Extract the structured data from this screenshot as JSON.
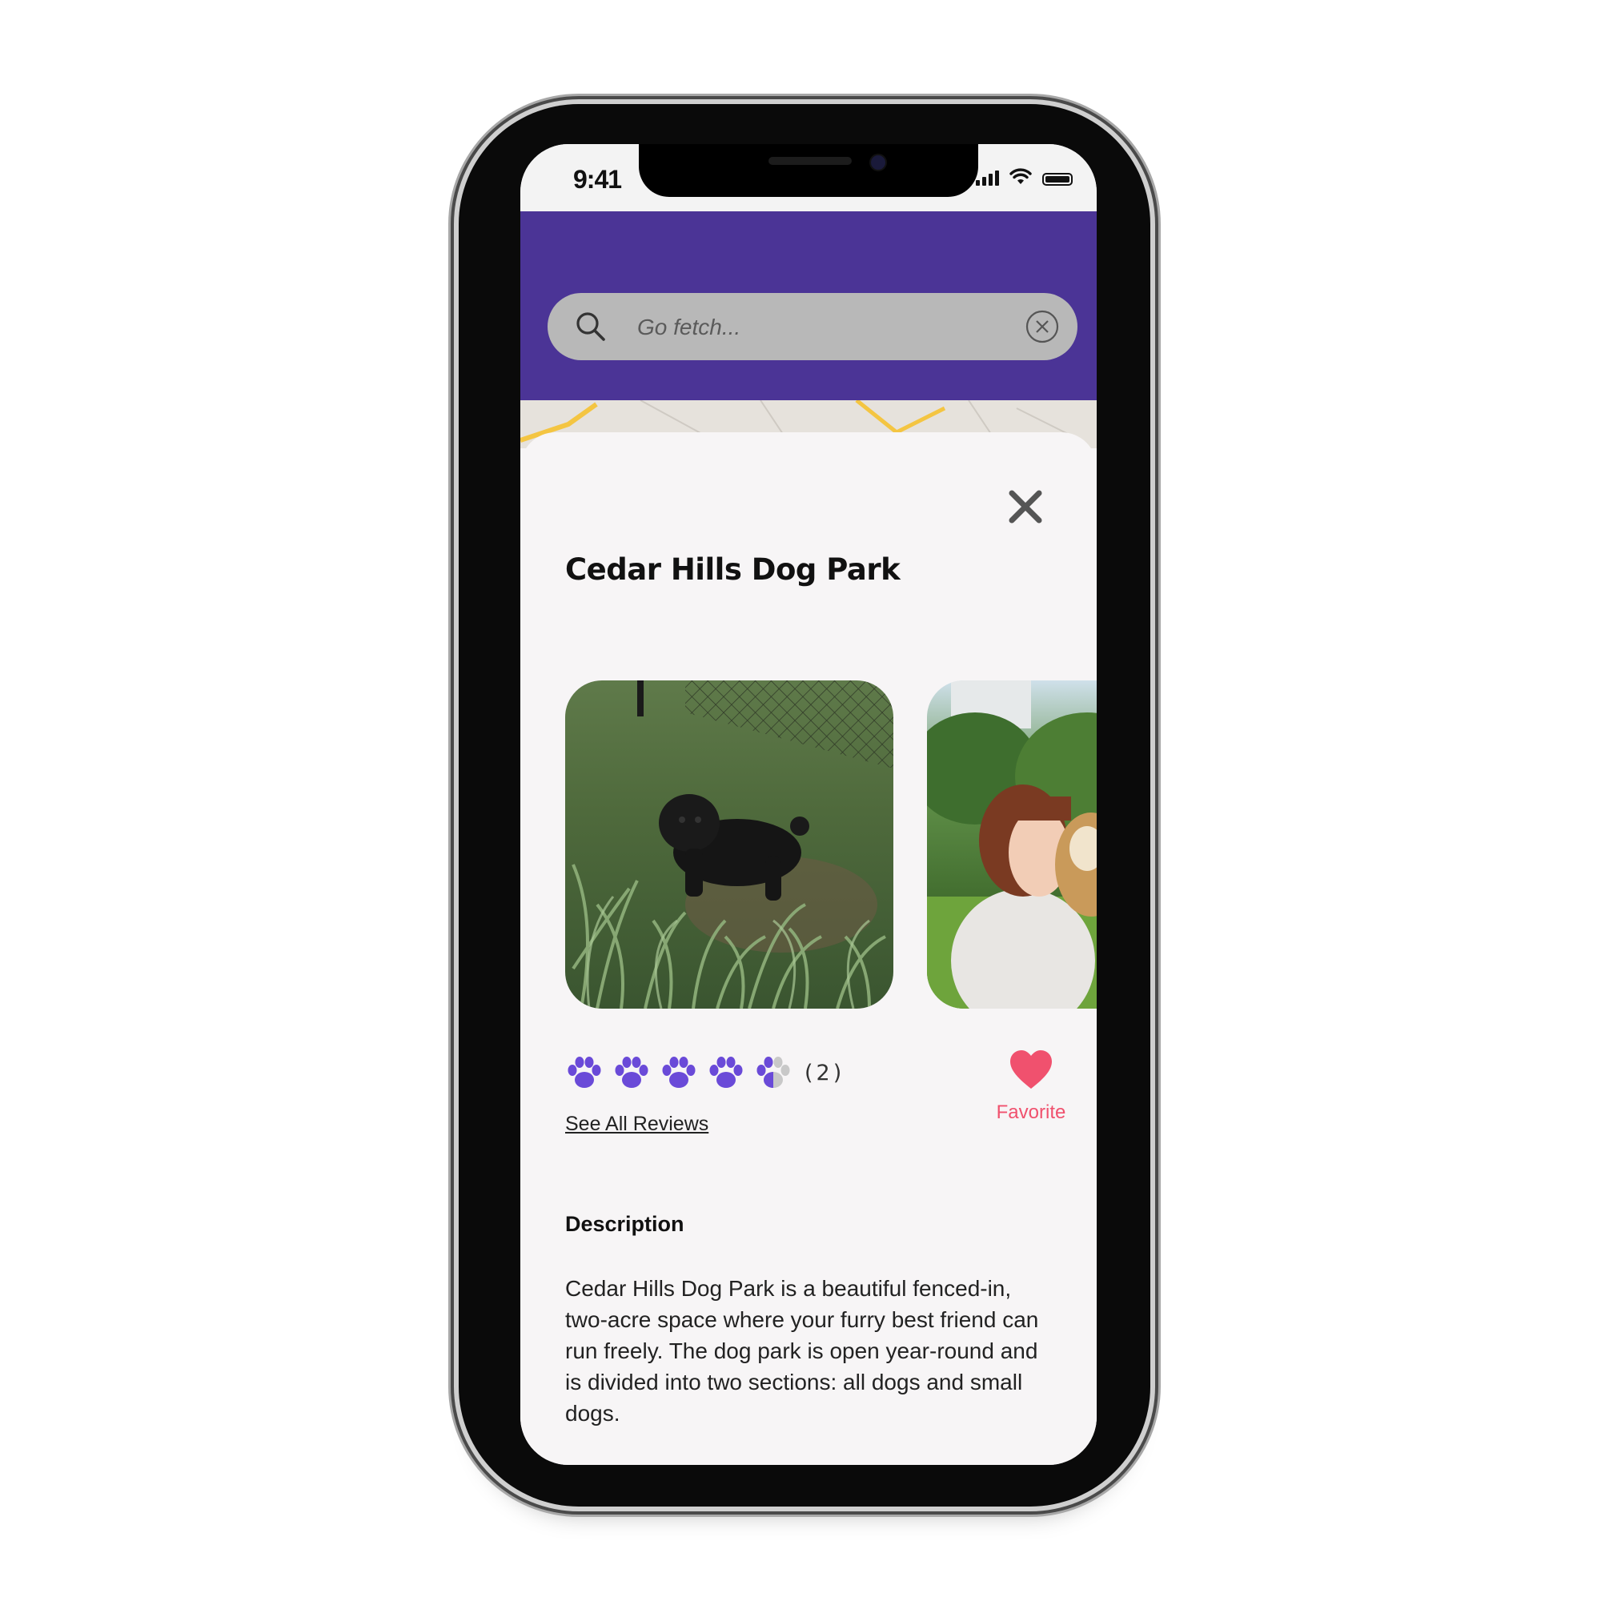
{
  "status_bar": {
    "time": "9:41"
  },
  "search": {
    "placeholder": "Go fetch..."
  },
  "park": {
    "name": "Cedar Hills Dog Park",
    "rating": 4.5,
    "rating_max": 5,
    "review_count": "(2)",
    "see_all_reviews": "See All Reviews",
    "favorite_label": "Favorite"
  },
  "description": {
    "heading": "Description",
    "text": "Cedar Hills Dog Park is a beautiful fenced-in, two-acre space where your furry best friend can run freely. The dog park is open year-round and is divided into two sections: all dogs and small dogs."
  },
  "colors": {
    "header": "#4b3496",
    "paw": "#6a4ad8",
    "paw_empty": "#c8c8c8",
    "favorite": "#f0516e"
  },
  "icons": {
    "search": "search-icon",
    "clear": "clear-circle-icon",
    "close": "close-icon",
    "paw": "paw-icon",
    "favorite": "heart-icon"
  }
}
